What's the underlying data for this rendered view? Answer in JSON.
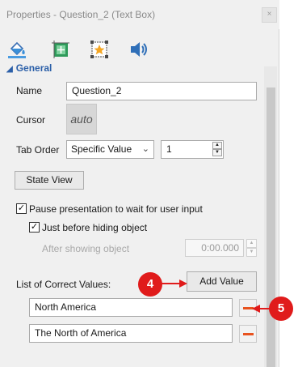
{
  "window": {
    "title": "Properties - Question_2 (Text Box)",
    "close_glyph": "×"
  },
  "toolbar": {
    "icons": [
      "paint-bucket-icon",
      "size-position-icon",
      "star-effect-icon",
      "audio-speaker-icon"
    ]
  },
  "section": {
    "title": "General"
  },
  "name_field": {
    "label": "Name",
    "value": "Question_2"
  },
  "cursor_field": {
    "label": "Cursor",
    "value": "auto"
  },
  "tab_order": {
    "label": "Tab Order",
    "mode": "Specific Value",
    "value": "1"
  },
  "state_view": {
    "label": "State View"
  },
  "pause": {
    "label": "Pause presentation to wait for user input",
    "checked": true
  },
  "just_before": {
    "label": "Just before hiding object",
    "checked": true
  },
  "after_showing": {
    "label": "After showing object",
    "value": "0:00.000"
  },
  "correct_values": {
    "label": "List of Correct Values:",
    "add_label": "Add Value",
    "items": [
      {
        "value": "North America"
      },
      {
        "value": "The North of America"
      }
    ]
  },
  "callouts": {
    "first": "4",
    "second": "5"
  },
  "colors": {
    "accent_blue": "#2b5fa8",
    "callout_red": "#e01b1b",
    "remove_orange": "#e8531f"
  }
}
